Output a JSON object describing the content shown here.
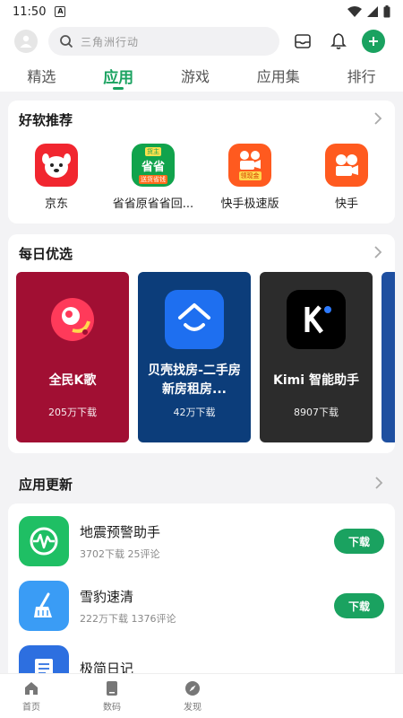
{
  "status_bar": {
    "time": "11:50",
    "a_badge": "A"
  },
  "search": {
    "placeholder": "三角洲行动"
  },
  "tabs": [
    {
      "label": "精选"
    },
    {
      "label": "应用",
      "active": true
    },
    {
      "label": "游戏"
    },
    {
      "label": "应用集"
    },
    {
      "label": "排行"
    }
  ],
  "recommend": {
    "title": "好软推荐",
    "items": [
      {
        "name": "京东",
        "icon": "jd-dog-icon",
        "color": "#f1262f"
      },
      {
        "name": "省省原省省回...",
        "icon": "shengsheng-icon",
        "color": "#11a34c",
        "icon_text": "省省",
        "icon_sub": "送货省钱",
        "icon_top": "货主"
      },
      {
        "name": "快手极速版",
        "icon": "kuaishou-lite-icon",
        "color": "#ff5a1f",
        "icon_sub": "领现金"
      },
      {
        "name": "快手",
        "icon": "kuaishou-icon",
        "color": "#ff5a1f"
      }
    ]
  },
  "daily": {
    "title": "每日优选",
    "items": [
      {
        "name": "全民K歌",
        "count": "205万下载",
        "bg": "#a10f33",
        "icon": "quanmin-kge-icon"
      },
      {
        "name": "贝壳找房-二手房新房租房...",
        "count": "42万下载",
        "bg": "#0c3d7a",
        "icon": "beike-icon"
      },
      {
        "name": "Kimi 智能助手",
        "count": "8907下载",
        "bg": "#2c2c2c",
        "icon": "kimi-icon"
      }
    ]
  },
  "updates": {
    "title": "应用更新",
    "items": [
      {
        "name": "地震预警助手",
        "meta": "3702下载  25评论",
        "button": "下载",
        "icon": "earthquake-icon",
        "color": "#1fbf64"
      },
      {
        "name": "雪豹速清",
        "meta": "222万下载  1376评论",
        "button": "下载",
        "icon": "broom-icon",
        "color": "#3a9cf5"
      },
      {
        "name": "极简日记",
        "meta": "",
        "button": "",
        "icon": "diary-icon",
        "color": "#2d6fe0"
      }
    ]
  },
  "bottom_nav": [
    {
      "label": "首页",
      "icon": "home-icon"
    },
    {
      "label": "数码",
      "icon": "phone-icon"
    },
    {
      "label": "发现",
      "icon": "compass-icon"
    }
  ],
  "colors": {
    "accent": "#1aa260"
  }
}
